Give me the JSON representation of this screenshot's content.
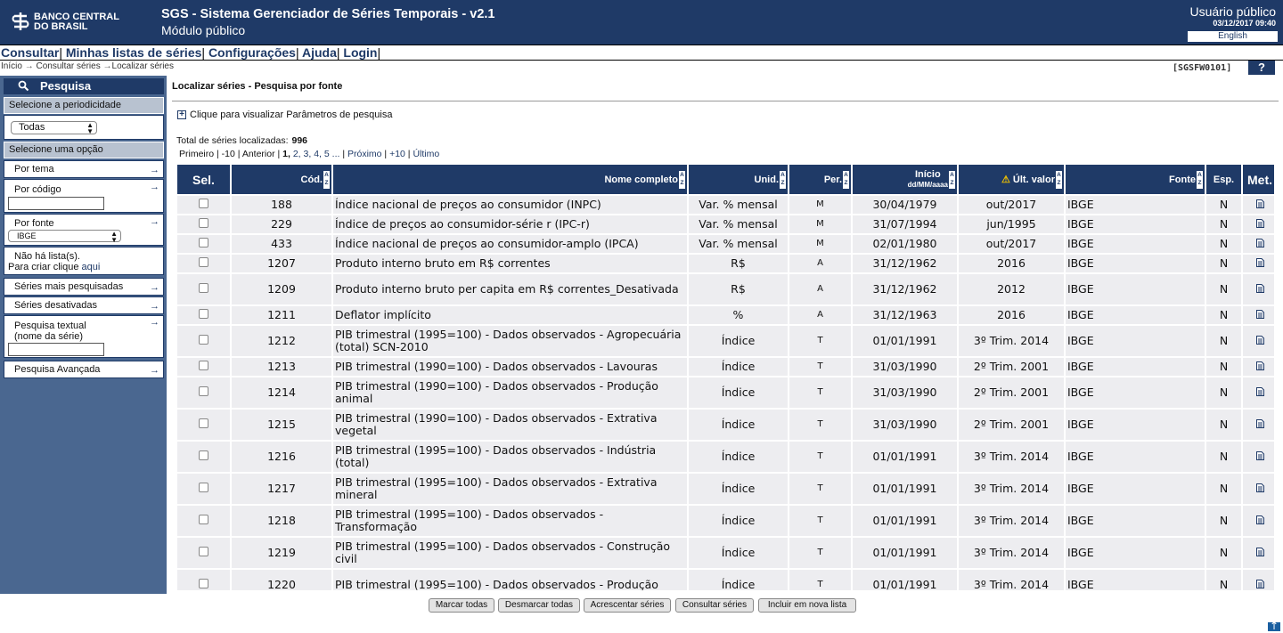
{
  "header": {
    "logo_line1": "BANCO CENTRAL",
    "logo_line2": "DO BRASIL",
    "title": "SGS - Sistema Gerenciador de Séries Temporais - v2.1",
    "subtitle": "Módulo público",
    "user": "Usuário público",
    "datetime": "03/12/2017 09:40",
    "language": "English"
  },
  "menu": {
    "consultar": "Consultar",
    "minhas_listas": "Minhas listas de séries",
    "configuracoes": "Configurações",
    "ajuda": "Ajuda",
    "login": "Login"
  },
  "breadcrumb": {
    "inicio": "Início",
    "consultar": "Consultar séries",
    "localizar": "Localizar séries"
  },
  "page_code": "[SGSFW0101]",
  "help_label": "?",
  "sidebar": {
    "title": "Pesquisa",
    "periodicidade_label": "Selecione a periodicidade",
    "periodicidade_value": "Todas",
    "opcao_label": "Selecione uma opção",
    "por_tema": "Por tema",
    "por_codigo": "Por código",
    "por_fonte": "Por fonte",
    "fonte_value": "IBGE",
    "lista_msg": "Não há lista(s).",
    "criar_msg": "Para criar clique",
    "criar_link": "aqui",
    "mais_pesquisadas": "Séries mais pesquisadas",
    "desativadas": "Séries desativadas",
    "pesquisa_textual": "Pesquisa textual",
    "nome_serie": "(nome da série)",
    "avancada": "Pesquisa Avançada"
  },
  "main": {
    "title": "Localizar séries - Pesquisa por fonte",
    "params_text": "Clique para visualizar Parâmetros de pesquisa",
    "total_label": "Total de séries localizadas:",
    "total_value": "996",
    "pager": {
      "primeiro": "Primeiro",
      "menos10": "-10",
      "anterior": "Anterior",
      "p1": "1,",
      "p2": "2,",
      "p3": "3,",
      "p4": "4,",
      "p5": "5 ...",
      "proximo": "Próximo",
      "mais10": "+10",
      "ultimo": "Último"
    }
  },
  "table": {
    "headers": {
      "sel": "Sel.",
      "cod": "Cód.",
      "nome": "Nome completo",
      "unid": "Unid.",
      "per": "Per.",
      "inicio": "Início",
      "inicio_fmt": "dd/MM/aaaa",
      "ult": "Últ. valor",
      "fonte": "Fonte",
      "esp": "Esp.",
      "met": "Met."
    },
    "rows": [
      {
        "cod": "188",
        "nome": "Índice nacional de preços ao consumidor (INPC)",
        "unid": "Var. % mensal",
        "per": "M",
        "inicio": "30/04/1979",
        "ult": "out/2017",
        "fonte": "IBGE",
        "esp": "N"
      },
      {
        "cod": "229",
        "nome": "Índice de preços ao consumidor-série r (IPC-r)",
        "unid": "Var. % mensal",
        "per": "M",
        "inicio": "31/07/1994",
        "ult": "jun/1995",
        "fonte": "IBGE",
        "esp": "N"
      },
      {
        "cod": "433",
        "nome": "Índice nacional de preços ao consumidor-amplo (IPCA)",
        "unid": "Var. % mensal",
        "per": "M",
        "inicio": "02/01/1980",
        "ult": "out/2017",
        "fonte": "IBGE",
        "esp": "N"
      },
      {
        "cod": "1207",
        "nome": "Produto interno bruto em R$ correntes",
        "unid": "R$",
        "per": "A",
        "inicio": "31/12/1962",
        "ult": "2016",
        "fonte": "IBGE",
        "esp": "N"
      },
      {
        "cod": "1209",
        "nome": "Produto interno bruto per capita em R$ correntes_Desativada",
        "unid": "R$",
        "per": "A",
        "inicio": "31/12/1962",
        "ult": "2012",
        "fonte": "IBGE",
        "esp": "N",
        "tall": true
      },
      {
        "cod": "1211",
        "nome": "Deflator implícito",
        "unid": "%",
        "per": "A",
        "inicio": "31/12/1963",
        "ult": "2016",
        "fonte": "IBGE",
        "esp": "N"
      },
      {
        "cod": "1212",
        "nome": "PIB trimestral (1995=100) - Dados observados - Agropecuária (total) SCN-2010",
        "unid": "Índice",
        "per": "T",
        "inicio": "01/01/1991",
        "ult": "3º Trim. 2014",
        "fonte": "IBGE",
        "esp": "N",
        "tall": true
      },
      {
        "cod": "1213",
        "nome": "PIB trimestral (1990=100) - Dados observados - Lavouras",
        "unid": "Índice",
        "per": "T",
        "inicio": "31/03/1990",
        "ult": "2º Trim. 2001",
        "fonte": "IBGE",
        "esp": "N"
      },
      {
        "cod": "1214",
        "nome": "PIB trimestral (1990=100) - Dados observados - Produção animal",
        "unid": "Índice",
        "per": "T",
        "inicio": "31/03/1990",
        "ult": "2º Trim. 2001",
        "fonte": "IBGE",
        "esp": "N",
        "tall": true
      },
      {
        "cod": "1215",
        "nome": "PIB trimestral (1990=100) - Dados observados - Extrativa vegetal",
        "unid": "Índice",
        "per": "T",
        "inicio": "31/03/1990",
        "ult": "2º Trim. 2001",
        "fonte": "IBGE",
        "esp": "N",
        "tall": true
      },
      {
        "cod": "1216",
        "nome": "PIB trimestral (1995=100) - Dados observados - Indústria (total)",
        "unid": "Índice",
        "per": "T",
        "inicio": "01/01/1991",
        "ult": "3º Trim. 2014",
        "fonte": "IBGE",
        "esp": "N",
        "tall": true
      },
      {
        "cod": "1217",
        "nome": "PIB trimestral (1995=100) - Dados observados - Extrativa mineral",
        "unid": "Índice",
        "per": "T",
        "inicio": "01/01/1991",
        "ult": "3º Trim. 2014",
        "fonte": "IBGE",
        "esp": "N",
        "tall": true
      },
      {
        "cod": "1218",
        "nome": "PIB trimestral (1995=100) - Dados observados - Transformação",
        "unid": "Índice",
        "per": "T",
        "inicio": "01/01/1991",
        "ult": "3º Trim. 2014",
        "fonte": "IBGE",
        "esp": "N",
        "tall": true
      },
      {
        "cod": "1219",
        "nome": "PIB trimestral (1995=100) - Dados observados - Construção civil",
        "unid": "Índice",
        "per": "T",
        "inicio": "01/01/1991",
        "ult": "3º Trim. 2014",
        "fonte": "IBGE",
        "esp": "N",
        "tall": true
      },
      {
        "cod": "1220",
        "nome": "PIB trimestral (1995=100) - Dados observados - Produção",
        "unid": "Índice",
        "per": "T",
        "inicio": "01/01/1991",
        "ult": "3º Trim. 2014",
        "fonte": "IBGE",
        "esp": "N",
        "tall": true
      }
    ]
  },
  "bottom_buttons": {
    "marcar": "Marcar todas",
    "desmarcar": "Desmarcar todas",
    "acrescentar": "Acrescentar séries",
    "consultar": "Consultar séries",
    "incluir": "Incluir em nova lista"
  },
  "colors": {
    "primary": "#1f3a67",
    "sidebar": "#4a6790",
    "row": "#ededf0"
  }
}
